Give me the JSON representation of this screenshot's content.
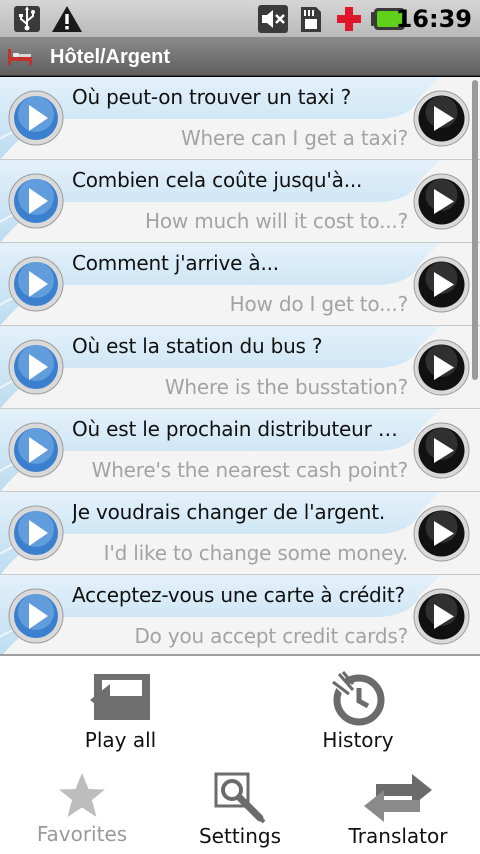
{
  "status_bar": {
    "time": "16:39",
    "icons": [
      "usb-icon",
      "warning-icon",
      "mute-icon",
      "sdcard-icon",
      "medical-cross-icon",
      "battery-icon"
    ]
  },
  "title_bar": {
    "title": "Hôtel/Argent",
    "icon": "bed-icon"
  },
  "phrases": [
    {
      "fr": "Où peut-on trouver un taxi ?",
      "en": "Where can I get a taxi?"
    },
    {
      "fr": "Combien cela coûte jusqu'à...",
      "en": "How much will it cost to...?"
    },
    {
      "fr": "Comment j'arrive à...",
      "en": "How do I get to...?"
    },
    {
      "fr": "Où est la station du bus ?",
      "en": "Where is the busstation?"
    },
    {
      "fr": "Où est le prochain distributeur de ...",
      "en": "Where's the nearest cash point?"
    },
    {
      "fr": "Je voudrais changer de l'argent.",
      "en": "I'd like to change some money."
    },
    {
      "fr": "Acceptez-vous une carte à crédit?",
      "en": "Do you accept credit cards?"
    }
  ],
  "menu": {
    "play_all": "Play all",
    "history": "History",
    "favorites": "Favorites",
    "settings": "Settings",
    "translator": "Translator"
  },
  "colors": {
    "row_accent": "#cfe6f5",
    "play_button": "#4a8fd6",
    "speak_button": "#1a1a1a"
  }
}
